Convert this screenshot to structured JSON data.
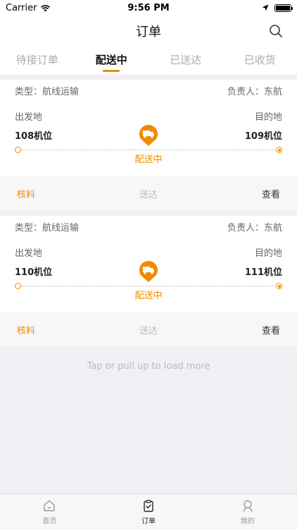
{
  "status_bar": {
    "carrier": "Carrier",
    "time": "9:56 PM"
  },
  "nav": {
    "title": "订单",
    "search_icon": "search-icon"
  },
  "tabs": [
    {
      "label": "待接订单",
      "active": false
    },
    {
      "label": "配送中",
      "active": true
    },
    {
      "label": "已送达",
      "active": false
    },
    {
      "label": "已收货",
      "active": false
    }
  ],
  "orders": [
    {
      "type": "类型：航线运输",
      "owner": "负责人：东航",
      "origin_label": "出发地",
      "dest_label": "目的地",
      "origin": "108机位",
      "dest": "109机位",
      "status": "配送中",
      "actions": {
        "inspect": "核料",
        "deliver": "送达",
        "view": "查看"
      }
    },
    {
      "type": "类型：航线运输",
      "owner": "负责人：东航",
      "origin_label": "出发地",
      "dest_label": "目的地",
      "origin": "110机位",
      "dest": "111机位",
      "status": "配送中",
      "actions": {
        "inspect": "核料",
        "deliver": "送达",
        "view": "查看"
      }
    }
  ],
  "load_more": "Tap or pull up to load more",
  "tabbar": [
    {
      "label": "首页",
      "icon": "home-icon",
      "active": false
    },
    {
      "label": "订单",
      "icon": "clipboard-icon",
      "active": true
    },
    {
      "label": "我的",
      "icon": "person-icon",
      "active": false
    }
  ],
  "colors": {
    "accent": "#f08c00",
    "background": "#efeff4"
  }
}
